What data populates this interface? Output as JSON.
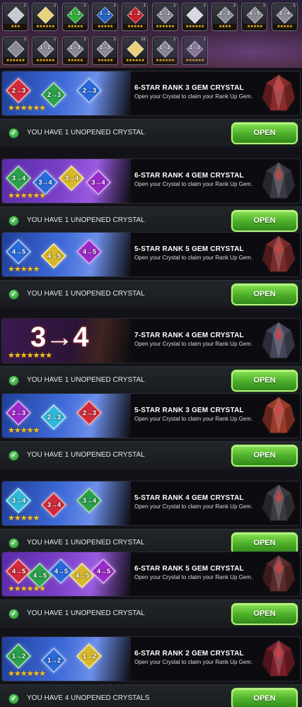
{
  "inventory": {
    "row1": [
      {
        "count": "2",
        "gem_label": "",
        "stars": "★★★",
        "color": "#c8c8d0"
      },
      {
        "count": "1",
        "gem_label": "",
        "stars": "★★★★★★",
        "color": "#e8d27a"
      },
      {
        "count": "1",
        "gem_label": "1→2",
        "stars": "★★★★★",
        "color": "#2fae3a"
      },
      {
        "count": "1",
        "gem_label": "1→2",
        "stars": "★★★★★",
        "color": "#2660c8"
      },
      {
        "count": "1",
        "gem_label": "1→2",
        "stars": "★★★★★",
        "color": "#c8202a"
      },
      {
        "count": "1",
        "gem_label": "1→2",
        "stars": "★★★★★★",
        "color": "#8a8a96"
      },
      {
        "count": "1",
        "gem_label": "",
        "stars": "★★★★★★",
        "color": "#d8d8e0"
      },
      {
        "count": "3",
        "gem_label": "2→3",
        "stars": "★★★★",
        "color": "#8a8a96"
      },
      {
        "count": "1",
        "gem_label": "4→5",
        "stars": "★★★★★",
        "color": "#8a8a96"
      },
      {
        "count": "1",
        "gem_label": "3→4",
        "stars": "★★★★★",
        "color": "#8a8a96"
      }
    ],
    "row2": [
      {
        "count": "1",
        "gem_label": "",
        "stars": "★★★★★★",
        "color": "#8a8a96"
      },
      {
        "count": "1",
        "gem_label": "1→2",
        "stars": "★★★★★★",
        "color": "#8a8a96"
      },
      {
        "count": "1",
        "gem_label": "2→3",
        "stars": "★★★★★",
        "color": "#8a8a96"
      },
      {
        "count": "1",
        "gem_label": "2→3",
        "stars": "★★★★★",
        "color": "#8a8a96"
      },
      {
        "count": "x1",
        "gem_label": "",
        "stars": "★★★★★★",
        "color": "#e8d27a"
      },
      {
        "count": "1",
        "gem_label": "1→2",
        "stars": "★★★★★★",
        "color": "#8a8a96"
      },
      {
        "count": "1",
        "gem_label": "2→3",
        "stars": "★★★★★★",
        "color": "#8a8a96"
      }
    ]
  },
  "crystals": [
    {
      "title": "6-STAR RANK 3 GEM CRYSTAL",
      "desc": "Open your Crystal to claim your Rank Up Gem.",
      "stars": "★★★★★★",
      "status": "YOU HAVE 1 UNOPENED CRYSTAL",
      "button": "OPEN",
      "art_gems": [
        "2→3",
        "2→3",
        "2→3"
      ],
      "big_label": "",
      "theme": "blue",
      "icon_color": "#8a2a2a"
    },
    {
      "title": "6-STAR RANK 4 GEM CRYSTAL",
      "desc": "Open your Crystal to claim your Rank Up Gem.",
      "stars": "★★★★★★",
      "status": "YOU HAVE 1 UNOPENED CRYSTAL",
      "button": "OPEN",
      "art_gems": [
        "3→4",
        "3→4",
        "3→4",
        "3→4"
      ],
      "big_label": "",
      "theme": "purple",
      "icon_color": "#3a3a44"
    },
    {
      "title": "5-STAR RANK 5 GEM CRYSTAL",
      "desc": "Open your Crystal to claim your Rank Up Gem.",
      "stars": "★★★★★",
      "status": "YOU HAVE 1 UNOPENED CRYSTAL",
      "button": "OPEN",
      "art_gems": [
        "4→5",
        "4→5",
        "4→5"
      ],
      "big_label": "",
      "theme": "blue",
      "icon_color": "#7a2a2a"
    },
    {
      "title": "7-STAR RANK 4 GEM CRYSTAL",
      "desc": "Open your Crystal to claim your Rank Up Gem.",
      "stars": "★★★★★★★",
      "status": "YOU HAVE 1 UNOPENED CRYSTAL",
      "button": "OPEN",
      "art_gems": [],
      "big_label": "3→4",
      "theme": "dark",
      "icon_color": "#44465a"
    },
    {
      "title": "5-STAR RANK 3 GEM CRYSTAL",
      "desc": "Open your Crystal to claim your Rank Up Gem.",
      "stars": "★★★★★",
      "status": "YOU HAVE 1 UNOPENED CRYSTAL",
      "button": "OPEN",
      "art_gems": [
        "2→3",
        "2→3",
        "2→3"
      ],
      "big_label": "",
      "theme": "blue",
      "icon_color": "#9a3a2a"
    },
    {
      "title": "5-STAR RANK 4 GEM CRYSTAL",
      "desc": "Open your Crystal to claim your Rank Up Gem.",
      "stars": "★★★★★",
      "status": "YOU HAVE 1 UNOPENED CRYSTAL",
      "button": "OPEN",
      "art_gems": [
        "3→4",
        "3→4",
        "3→4"
      ],
      "big_label": "",
      "theme": "blue",
      "icon_color": "#3a3a40"
    },
    {
      "title": "6-STAR RANK 5 GEM CRYSTAL",
      "desc": "Open your Crystal to claim your Rank Up Gem.",
      "stars": "★★★★★★",
      "status": "YOU HAVE 1 UNOPENED CRYSTAL",
      "button": "OPEN",
      "art_gems": [
        "4→5",
        "4→5",
        "4→5",
        "4→5",
        "4→5"
      ],
      "big_label": "",
      "theme": "purple",
      "icon_color": "#5a2a2a"
    },
    {
      "title": "6-STAR RANK 2 GEM CRYSTAL",
      "desc": "Open your Crystal to claim your Rank Up Gem.",
      "stars": "★★★★★★",
      "status": "YOU HAVE 4 UNOPENED CRYSTALS",
      "button": "OPEN",
      "art_gems": [
        "1→2",
        "1→2",
        "1→2"
      ],
      "big_label": "",
      "theme": "blue",
      "icon_color": "#7a1e2a"
    }
  ]
}
